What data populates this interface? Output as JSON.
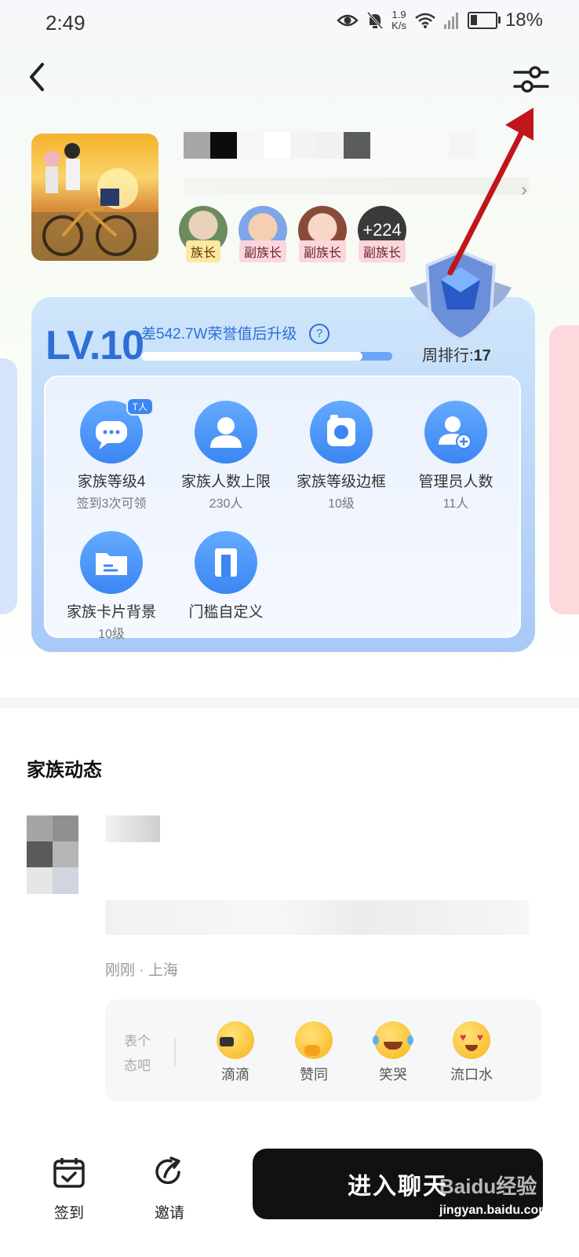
{
  "status_bar": {
    "time": "2:49",
    "net_speed_value": "1.9",
    "net_speed_unit": "K/s",
    "battery": "18%",
    "icons": [
      "eye-icon",
      "bell-muted-icon",
      "wifi-icon",
      "signal-icon",
      "battery-icon"
    ]
  },
  "header": {
    "back_icon": "chevron-left-icon",
    "settings_icon": "sliders-icon"
  },
  "family": {
    "members": [
      {
        "role": "族长",
        "avatar_color": "#cfd8c4"
      },
      {
        "role": "副族长",
        "avatar_color": "#7fa6e8"
      },
      {
        "role": "副族长",
        "avatar_color": "#e9c2b8"
      },
      {
        "role": "副族长",
        "more": "+224",
        "avatar_color": "#3a3a3a"
      }
    ]
  },
  "level": {
    "label": "LV.10",
    "upgrade_tip": "差542.7W荣誉值后升级",
    "help": "?",
    "progress": 0.88,
    "week_rank_label": "周排行:",
    "week_rank_value": "17"
  },
  "perks": [
    {
      "name": "家族等级4",
      "sub": "签到3次可领",
      "tag": "T人",
      "icon": "chat-bubble-icon"
    },
    {
      "name": "家族人数上限",
      "sub": "230人",
      "icon": "person-icon"
    },
    {
      "name": "家族等级边框",
      "sub": "10级",
      "icon": "frame-icon"
    },
    {
      "name": "管理员人数",
      "sub": "11人",
      "icon": "add-admin-icon"
    },
    {
      "name": "家族卡片背景",
      "sub": "10级",
      "icon": "card-icon"
    },
    {
      "name": "门槛自定义",
      "sub": "",
      "icon": "door-icon"
    }
  ],
  "feed": {
    "title": "家族动态",
    "meta": "刚刚 · 上海",
    "react_prompt": "表个态吧",
    "reactions": [
      {
        "label": "滴滴",
        "icon": "megaphone-emoji-icon"
      },
      {
        "label": "赞同",
        "icon": "thumbs-up-emoji-icon"
      },
      {
        "label": "笑哭",
        "icon": "laugh-cry-emoji-icon"
      },
      {
        "label": "流口水",
        "icon": "heart-eyes-emoji-icon"
      }
    ]
  },
  "bottom_nav": {
    "checkin": "签到",
    "invite": "邀请",
    "enter_chat": "进入聊天"
  },
  "watermark": {
    "main": "Baidu经验",
    "sub": "jingyan.baidu.com"
  },
  "colors": {
    "accent_blue": "#2d6fd6",
    "annotation_arrow": "#c0161b",
    "button_dark": "#111111"
  }
}
